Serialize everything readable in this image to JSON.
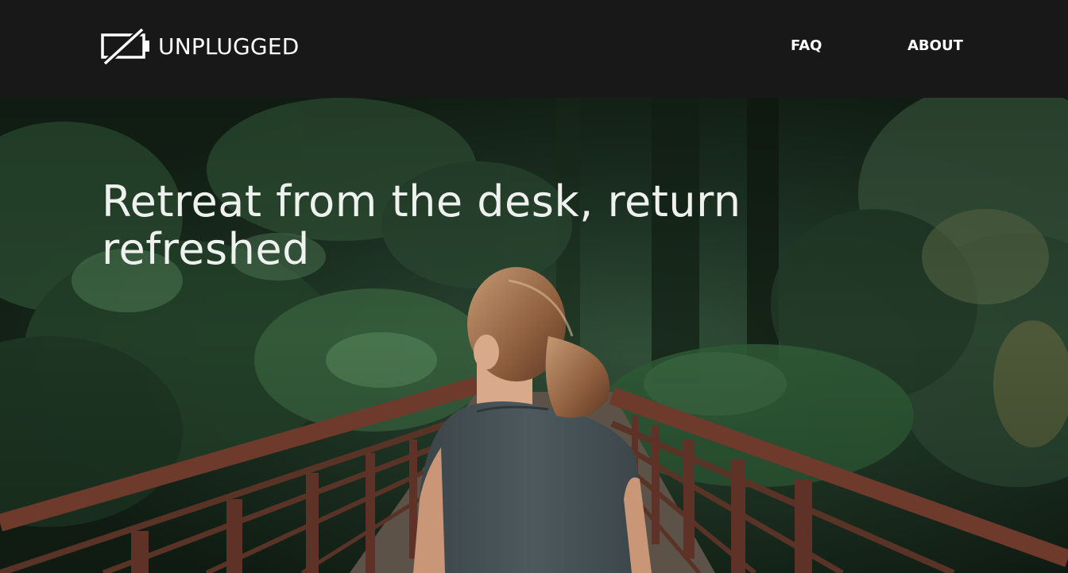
{
  "navbar": {
    "brand": "UNPLUGGED",
    "brand_icon": "battery-crossed-icon",
    "links": [
      {
        "label": "FAQ"
      },
      {
        "label": "ABOUT"
      }
    ]
  },
  "hero": {
    "headline": "Retreat from the desk, return refreshed",
    "image": "woman-on-forest-bridge-photo"
  },
  "colors": {
    "navbar_bg": "#181818",
    "nav_text": "#ffffff",
    "headline_text": "#eef1ee",
    "forest_dark": "#1a2a1c",
    "rail_rust": "#6e3a2c"
  }
}
